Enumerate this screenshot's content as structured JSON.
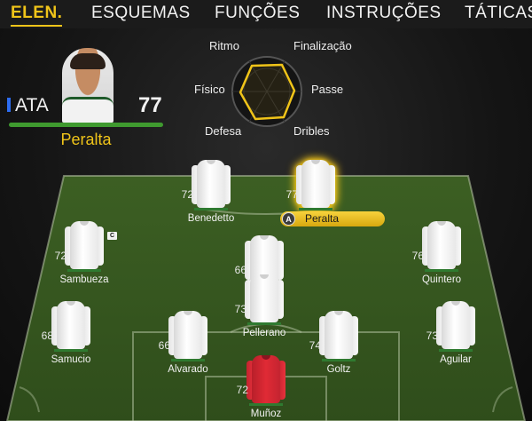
{
  "tabs": [
    "ELEN.",
    "ESQUEMAS",
    "FUNÇÕES",
    "INSTRUÇÕES",
    "TÁTICAS"
  ],
  "active_tab": "ELEN.",
  "selected_player": {
    "position": "ATA",
    "overall": "77",
    "name": "Peralta"
  },
  "radar": {
    "labels": {
      "top_left": "Ritmo",
      "top_right": "Finalização",
      "left": "Físico",
      "right": "Passe",
      "bottom_left": "Defesa",
      "bottom_right": "Dribles"
    }
  },
  "lineup": [
    {
      "name": "Benedetto",
      "rating": "72",
      "role": "field"
    },
    {
      "name": "Peralta",
      "rating": "77",
      "role": "field",
      "selected": true,
      "button": "A"
    },
    {
      "name": "Sambueza",
      "rating": "72",
      "role": "field",
      "badge": "C"
    },
    {
      "name": "Quintero",
      "rating": "76",
      "role": "field"
    },
    {
      "name": "",
      "rating": "66",
      "role": "field",
      "partial_name": "...z"
    },
    {
      "name": "Pellerano",
      "rating": "73",
      "role": "field"
    },
    {
      "name": "Samucio",
      "rating": "68",
      "role": "field"
    },
    {
      "name": "Aguilar",
      "rating": "73",
      "role": "field"
    },
    {
      "name": "Alvarado",
      "rating": "66",
      "role": "field"
    },
    {
      "name": "Goltz",
      "rating": "74",
      "role": "field"
    },
    {
      "name": "Muñoz",
      "rating": "72",
      "role": "goalkeeper"
    }
  ],
  "colors": {
    "accent": "#f0c419",
    "pitch": "#3e6b24",
    "position_marker": "#2d6cf0",
    "kit": "#ffffff",
    "gk_kit": "#e02a35"
  }
}
